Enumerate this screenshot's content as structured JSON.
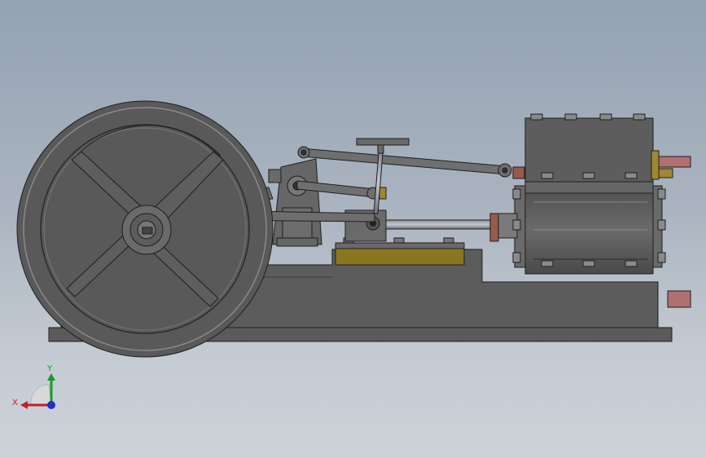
{
  "viewport": {
    "background_top": "#94a2b3",
    "background_bottom": "#cdd2d8"
  },
  "model": {
    "metal_color": "#5f5f5f",
    "edge_color": "#1e1e1e",
    "brass_color": "#8a7620",
    "copper_color": "#9a5a4a"
  },
  "triad": {
    "x_label": "X",
    "y_label": "Y",
    "x_color": "#c0202a",
    "y_color": "#1a9a2a",
    "z_color": "#2030c8"
  }
}
